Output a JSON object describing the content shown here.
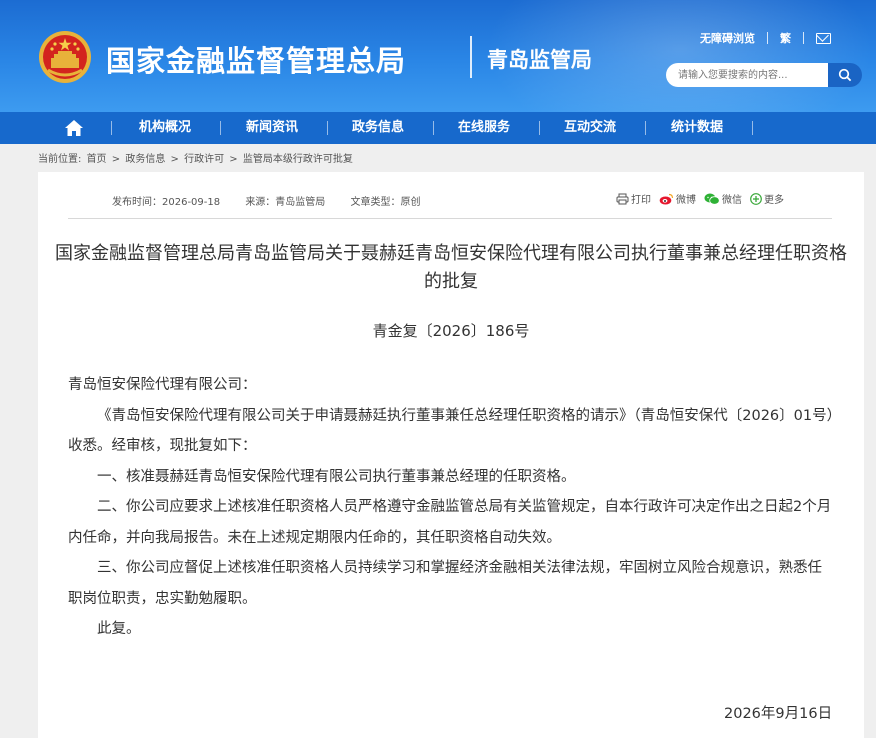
{
  "header": {
    "site_title": "国家金融监督管理总局",
    "sub_title": "青岛监管局",
    "top_links": {
      "accessibility": "无障碍浏览",
      "traditional": "繁"
    },
    "search": {
      "placeholder": "请输入您要搜索的内容..."
    },
    "icons": [
      "national-emblem-icon",
      "mail-icon",
      "search-icon"
    ],
    "colors": {
      "header_blue": "#1c6cd2",
      "nav_blue": "#1769cc"
    }
  },
  "nav": {
    "items": [
      "机构概况",
      "新闻资讯",
      "政务信息",
      "在线服务",
      "互动交流",
      "统计数据"
    ],
    "home_icon": "home-icon"
  },
  "breadcrumb": {
    "label": "当前位置:",
    "items": [
      "首页",
      "政务信息",
      "行政许可",
      "监管局本级行政许可批复"
    ],
    "separator": ">"
  },
  "article": {
    "meta": {
      "publish_time": "发布时间：2026-09-18",
      "source": "来源：青岛监管局",
      "type": "文章类型：原创"
    },
    "share": {
      "print": "打印",
      "weibo": "微博",
      "wechat": "微信",
      "more": "更多"
    },
    "title": "国家金融监督管理总局青岛监管局关于聂赫廷青岛恒安保险代理有限公司执行董事兼总经理任职资格的批复",
    "doc_number": "青金复〔2026〕186号",
    "salutation": "青岛恒安保险代理有限公司：",
    "paragraphs": [
      "《青岛恒安保险代理有限公司关于申请聂赫廷执行董事兼任总经理任职资格的请示》（青岛恒安保代〔2026〕01号）收悉。经审核，现批复如下：",
      "一、核准聂赫廷青岛恒安保险代理有限公司执行董事兼总经理的任职资格。",
      "二、你公司应要求上述核准任职资格人员严格遵守金融监管总局有关监管规定，自本行政许可决定作出之日起2个月内任命，并向我局报告。未在上述规定期限内任命的，其任职资格自动失效。",
      "三、你公司应督促上述核准任职资格人员持续学习和掌握经济金融相关法律法规，牢固树立风险合规意识，熟悉任职岗位职责，忠实勤勉履职。",
      "此复。"
    ],
    "date": "2026年9月16日"
  }
}
